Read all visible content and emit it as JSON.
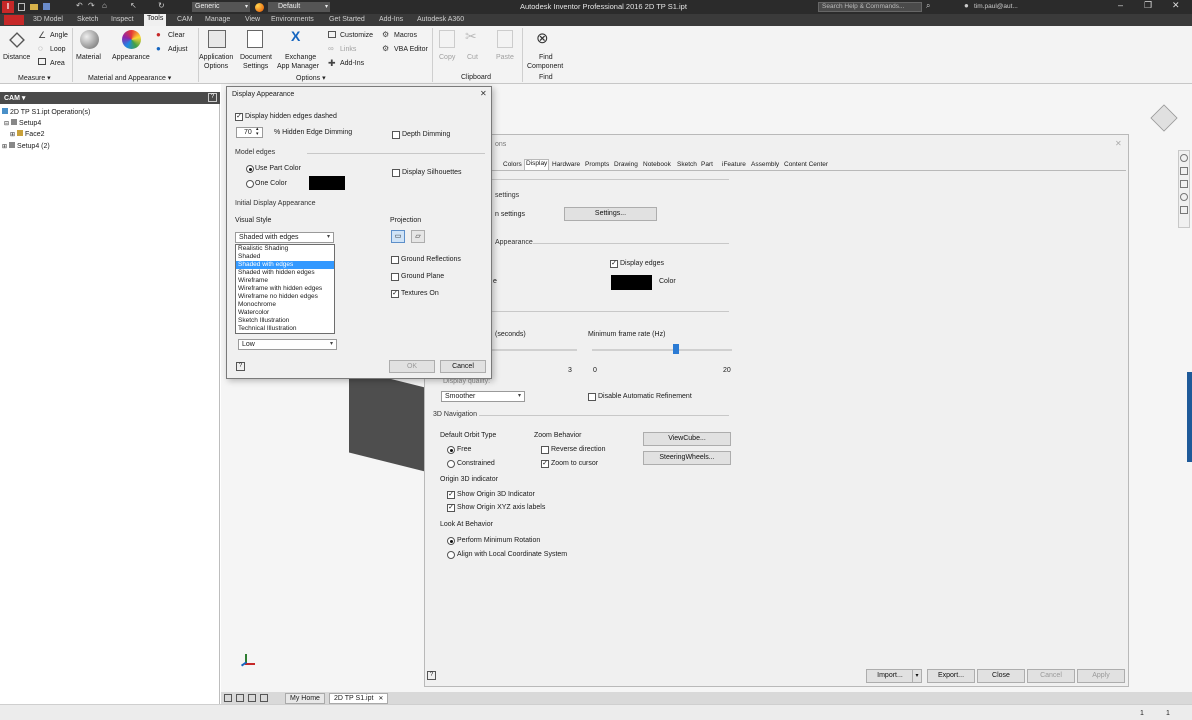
{
  "app": {
    "title": "Autodesk Inventor Professional 2016   2D TP S1.ipt",
    "appearance_value": "Generic",
    "lod_value": "Default",
    "search_placeholder": "Search Help & Commands...",
    "user_name": "tim.paul@aut..."
  },
  "menu_tabs": [
    "3D Model",
    "Sketch",
    "Inspect",
    "Tools",
    "CAM",
    "Manage",
    "View",
    "Environments",
    "Get Started",
    "Add-Ins",
    "Autodesk A360"
  ],
  "ribbon": {
    "measure": {
      "distance": "Distance",
      "angle": "Angle",
      "loop": "Loop",
      "area": "Area",
      "title": "Measure ▾"
    },
    "material_appearance": {
      "material": "Material",
      "appearance": "Appearance",
      "clear": "Clear",
      "adjust": "Adjust",
      "title": "Material and Appearance ▾"
    },
    "options": {
      "app_options_1": "Application",
      "app_options_2": "Options",
      "doc_settings_1": "Document",
      "doc_settings_2": "Settings",
      "exchange_1": "Exchange",
      "exchange_2": "App Manager",
      "customize": "Customize",
      "links": "Links",
      "addins": "Add-Ins",
      "macros": "Macros",
      "vba": "VBA Editor",
      "title": "Options ▾"
    },
    "clipboard": {
      "copy": "Copy",
      "cut": "Cut",
      "paste": "Paste",
      "title": "Clipboard"
    },
    "find": {
      "find_1": "Find",
      "find_2": "Component",
      "title": "Find"
    }
  },
  "browser": {
    "header": "CAM ▾",
    "items": [
      "2D TP S1.ipt Operation(s)",
      "Setup4",
      "Face2",
      "Setup4 (2)"
    ]
  },
  "app_options": {
    "title_fragment": "ons",
    "tabs": [
      "Colors",
      "Display",
      "Hardware",
      "Prompts",
      "Drawing",
      "Notebook",
      "Sketch",
      "Part",
      "iFeature",
      "Assembly",
      "Content Center"
    ],
    "settings_label": "settings",
    "use_settings_label": "n settings",
    "settings_button": "Settings...",
    "appearance_section": "Appearance",
    "display_edges": "Display edges",
    "color_label": "Color",
    "left_fragment": "e",
    "seconds_label": "(seconds)",
    "seconds_max": "3",
    "min_frame_label": "Minimum frame rate (Hz)",
    "frame_min": "0",
    "frame_max": "20",
    "frame_value": 0.6,
    "display_quality_label": "Display quality:",
    "display_quality_value": "Smoother",
    "disable_refinement": "Disable Automatic Refinement",
    "nav3d_section": "3D Navigation",
    "default_orbit": "Default Orbit Type",
    "free": "Free",
    "constrained": "Constrained",
    "zoom_behavior": "Zoom Behavior",
    "reverse_direction": "Reverse direction",
    "zoom_to_cursor": "Zoom to cursor",
    "viewcube_button": "ViewCube...",
    "steering_button": "SteeringWheels...",
    "origin_indicator": "Origin 3D indicator",
    "show_origin": "Show Origin 3D Indicator",
    "show_axis_labels": "Show Origin XYZ axis labels",
    "look_at": "Look At Behavior",
    "min_rotation": "Perform Minimum Rotation",
    "align_local": "Align with Local Coordinate System",
    "import_button": "Import...",
    "export_button": "Export...",
    "close_button": "Close",
    "cancel_button": "Cancel",
    "apply_button": "Apply"
  },
  "display_appearance": {
    "title": "Display Appearance",
    "hidden_edges_dashed": "Display hidden edges dashed",
    "dimming_value": "70",
    "hidden_edge_dimming": "% Hidden Edge Dimming",
    "depth_dimming": "Depth Dimming",
    "model_edges": "Model edges",
    "use_part_color": "Use Part Color",
    "one_color": "One Color",
    "display_silhouettes": "Display Silhouettes",
    "initial_display": "Initial Display Appearance",
    "visual_style": "Visual Style",
    "visual_style_value": "Shaded with edges",
    "visual_style_options": [
      "Realistic Shading",
      "Shaded",
      "Shaded with edges",
      "Shaded with hidden edges",
      "Wireframe",
      "Wireframe with hidden edges",
      "Wireframe no hidden edges",
      "Monochrome",
      "Watercolor",
      "Sketch Illustration",
      "Technical Illustration"
    ],
    "projection": "Projection",
    "ground_reflections": "Ground Reflections",
    "ground_plane": "Ground Plane",
    "textures_on": "Textures On",
    "quality_value": "Low",
    "ok_button": "OK",
    "cancel_button": "Cancel"
  },
  "doc_tabs": {
    "home": "My Home",
    "doc": "2D TP S1.ipt"
  },
  "status": {
    "left": "1",
    "right": "1"
  }
}
